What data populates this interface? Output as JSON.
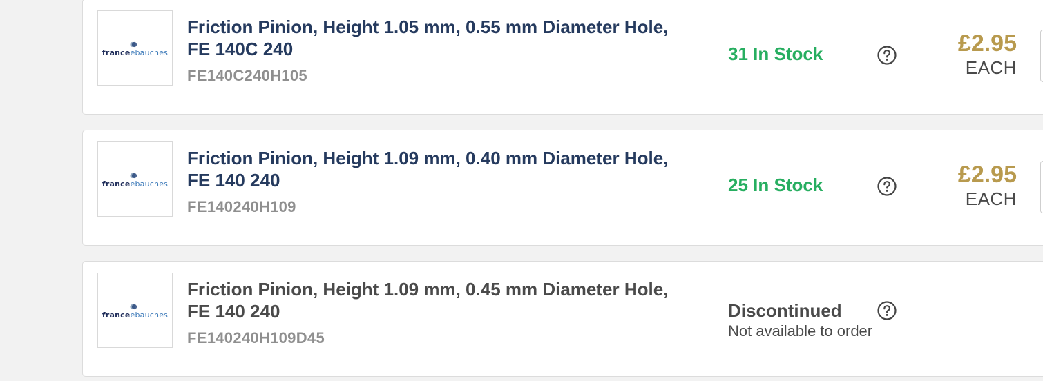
{
  "brand": {
    "logo_part1": "france",
    "logo_part2": "ebauches"
  },
  "products": [
    {
      "title": "Friction Pinion, Height 1.05 mm, 0.55 mm Diameter Hole, FE 140C 240",
      "sku": "FE140C240H105",
      "stock": "31 In Stock",
      "price": "£2.95",
      "unit": "EACH"
    },
    {
      "title": "Friction Pinion, Height 1.09 mm, 0.40 mm Diameter Hole, FE 140 240",
      "sku": "FE140240H109",
      "stock": "25 In Stock",
      "price": "£2.95",
      "unit": "EACH"
    },
    {
      "title": "Friction Pinion, Height 1.09 mm, 0.45 mm Diameter Hole, FE 140 240",
      "sku": "FE140240H109D45",
      "status": "Discontinued",
      "status_note": "Not available to order"
    }
  ],
  "colors": {
    "title": "#253a5e",
    "in_stock": "#27ae60",
    "price": "#b89a4e",
    "sku": "#8f8f8f"
  },
  "icons": {
    "help": "question-circle-icon",
    "logo": "france-ebauches-logo"
  }
}
